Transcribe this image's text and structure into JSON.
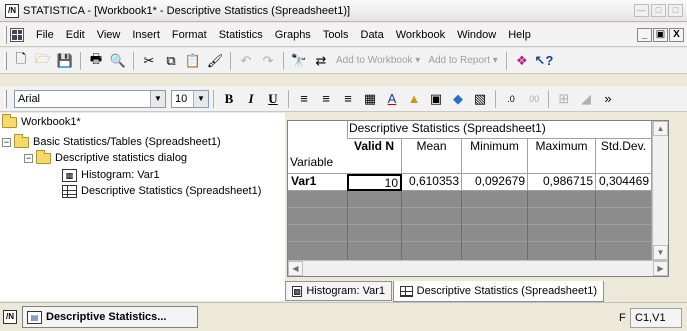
{
  "window": {
    "title": "STATISTICA - [Workbook1* - Descriptive Statistics (Spreadsheet1)]",
    "app_icon_label": "/N"
  },
  "menu": {
    "items": [
      {
        "label": "File"
      },
      {
        "label": "Edit"
      },
      {
        "label": "View"
      },
      {
        "label": "Insert"
      },
      {
        "label": "Format"
      },
      {
        "label": "Statistics"
      },
      {
        "label": "Graphs"
      },
      {
        "label": "Tools"
      },
      {
        "label": "Data"
      },
      {
        "label": "Workbook"
      },
      {
        "label": "Window"
      },
      {
        "label": "Help"
      }
    ],
    "mdi_min": "_",
    "mdi_restore": "▣",
    "mdi_close": "X"
  },
  "toolbar": {
    "add_to_workbook": "Add to Workbook ▾",
    "add_to_report": "Add to Report ▾"
  },
  "format_toolbar": {
    "font": "Arial",
    "size": "10",
    "bold": "B",
    "italic": "I",
    "underline": "U"
  },
  "tree": {
    "root": "Workbook1*",
    "group": "Basic Statistics/Tables (Spreadsheet1)",
    "dialog": "Descriptive statistics dialog",
    "histogram": "Histogram: Var1",
    "spreadsheet": "Descriptive Statistics (Spreadsheet1)"
  },
  "sheet": {
    "title": "Descriptive Statistics (Spreadsheet1)",
    "row_header_label": "Variable",
    "columns": [
      "Valid N",
      "Mean",
      "Minimum",
      "Maximum",
      "Std.Dev."
    ],
    "rows": [
      {
        "name": "Var1",
        "values": [
          "10",
          "0,610353",
          "0,092679",
          "0,986715",
          "0,304469"
        ]
      }
    ]
  },
  "tabs": {
    "histogram": "Histogram: Var1",
    "spreadsheet": "Descriptive Statistics (Spreadsheet1)"
  },
  "status": {
    "task_label": "Descriptive Statistics...",
    "panel_f": "F",
    "cell_ref": "C1,V1"
  }
}
